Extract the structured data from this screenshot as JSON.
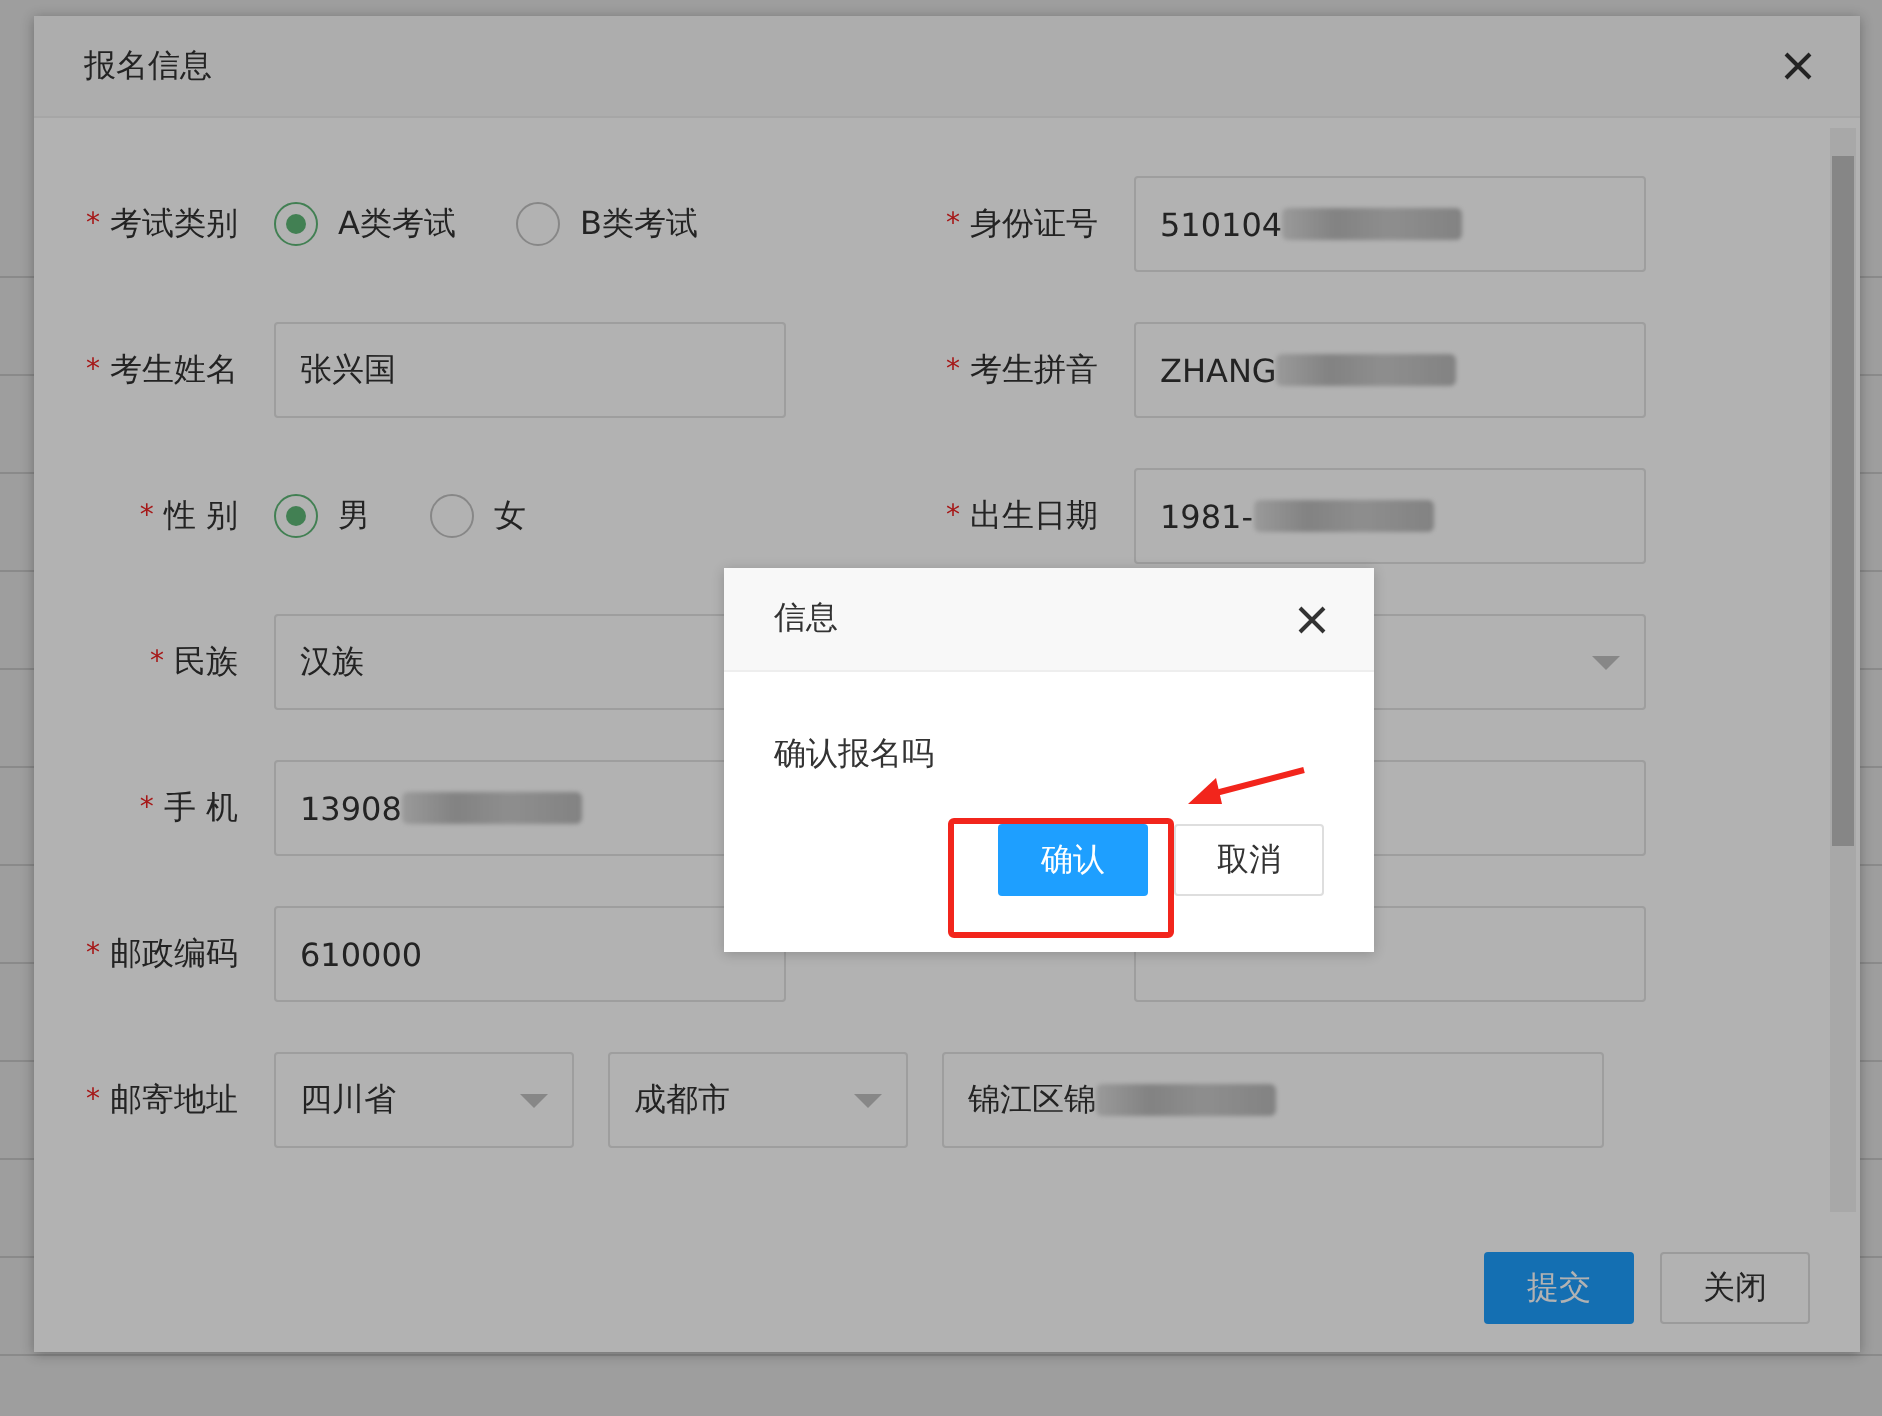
{
  "dialog": {
    "title": "报名信息",
    "rows": [
      {
        "left": {
          "label": "考试类别",
          "marker": "*",
          "kind": "radio",
          "options": [
            {
              "label": "A类考试",
              "selected": true
            },
            {
              "label": "B类考试",
              "selected": false
            }
          ]
        },
        "right": {
          "label": "身份证号",
          "marker": "*",
          "kind": "text",
          "value": "510104",
          "masked": true
        }
      },
      {
        "left": {
          "label": "考生姓名",
          "marker": "*",
          "kind": "text",
          "value": "张兴国"
        },
        "right": {
          "label": "考生拼音",
          "marker": "*",
          "kind": "text",
          "value": "ZHANG",
          "masked": true
        }
      },
      {
        "left": {
          "label": "性 别",
          "marker": "*",
          "kind": "radio",
          "options": [
            {
              "label": "男",
              "selected": true
            },
            {
              "label": "女",
              "selected": false
            }
          ]
        },
        "right": {
          "label": "出生日期",
          "marker": "*",
          "kind": "text",
          "value": "1981-",
          "masked": true
        }
      },
      {
        "left": {
          "label": "民族",
          "marker": "*",
          "kind": "select",
          "value": "汉族"
        },
        "right": {
          "kind": "select"
        }
      },
      {
        "left": {
          "label": "手 机",
          "marker": "*",
          "kind": "text",
          "value": "13908",
          "masked": true
        },
        "right": {
          "kind": "text"
        }
      },
      {
        "left": {
          "label": "邮政编码",
          "marker": "*",
          "kind": "text",
          "value": "610000"
        },
        "right": {
          "kind": "text"
        }
      },
      {
        "left": {
          "label": "邮寄地址",
          "marker": "*",
          "kind": "address",
          "province": "四川省",
          "city": "成都市",
          "value": "锦江区锦",
          "masked": true
        }
      }
    ],
    "buttons": [
      {
        "label": "提交",
        "kind": "primary"
      },
      {
        "label": "关闭",
        "kind": "default"
      }
    ]
  },
  "confirm": {
    "title": "信息",
    "message": "确认报名吗",
    "buttons": [
      {
        "label": "确认",
        "kind": "primary"
      },
      {
        "label": "取消",
        "kind": "default"
      }
    ]
  }
}
